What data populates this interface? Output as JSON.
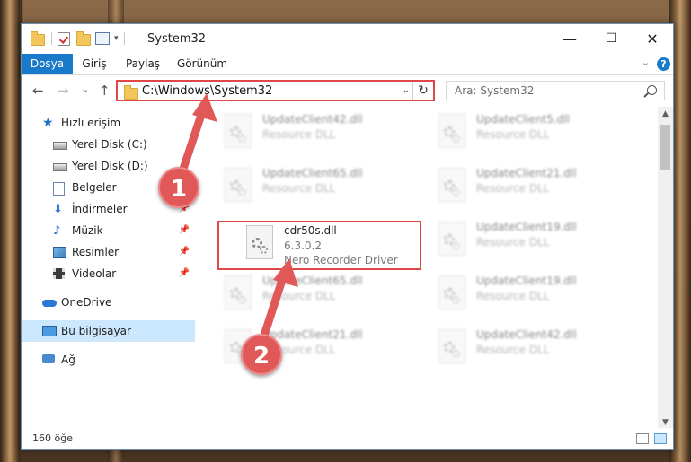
{
  "window": {
    "title": "System32",
    "minimize": "—",
    "maximize": "☐",
    "close": "✕"
  },
  "ribbon": {
    "tabs": [
      {
        "label": "Dosya",
        "active": true
      },
      {
        "label": "Giriş",
        "active": false
      },
      {
        "label": "Paylaş",
        "active": false
      },
      {
        "label": "Görünüm",
        "active": false
      }
    ],
    "help": "?"
  },
  "nav": {
    "back": "←",
    "forward": "→",
    "recent": "⌄",
    "up": "↑",
    "address": "C:\\Windows\\System32",
    "refresh": "↻",
    "search_placeholder": "Ara: System32"
  },
  "sidebar": {
    "items": [
      {
        "label": "Hızlı erişim",
        "icon": "star-icon"
      },
      {
        "label": "Yerel Disk (C:)",
        "icon": "disk-icon"
      },
      {
        "label": "Yerel Disk (D:)",
        "icon": "disk-icon"
      },
      {
        "label": "Belgeler",
        "icon": "documents-icon"
      },
      {
        "label": "İndirmeler",
        "icon": "downloads-icon"
      },
      {
        "label": "Müzik",
        "icon": "music-icon"
      },
      {
        "label": "Resimler",
        "icon": "pictures-icon"
      },
      {
        "label": "Videolar",
        "icon": "videos-icon"
      },
      {
        "label": "OneDrive",
        "icon": "cloud-icon"
      },
      {
        "label": "Bu bilgisayar",
        "icon": "computer-icon",
        "selected": true
      },
      {
        "label": "Ağ",
        "icon": "network-icon"
      }
    ]
  },
  "files": [
    {
      "name": "UpdateClient42.dll",
      "type": "Resource DLL"
    },
    {
      "name": "UpdateClient5.dll",
      "type": "Resource DLL"
    },
    {
      "name": "UpdateClient65.dll",
      "type": "Resource DLL"
    },
    {
      "name": "UpdateClient21.dll",
      "type": "Resource DLL"
    },
    {
      "name": "cdr50s.dll",
      "version": "6.3.0.2",
      "type": "Nero Recorder Driver",
      "highlighted": true
    },
    {
      "name": "UpdateClient19.dll",
      "type": "Resource DLL"
    },
    {
      "name": "UpdateClient65.dll",
      "type": "Resource DLL"
    },
    {
      "name": "UpdateClient19.dll",
      "type": "Resource DLL"
    },
    {
      "name": "UpdateClient21.dll",
      "type": "Resource DLL"
    },
    {
      "name": "UpdateClient42.dll",
      "type": "Resource DLL"
    }
  ],
  "status": {
    "count": "160 öğe"
  },
  "callouts": {
    "one": "1",
    "two": "2"
  },
  "colors": {
    "accent": "#1979ca",
    "highlight": "#e04848",
    "selection": "#cce8ff"
  }
}
